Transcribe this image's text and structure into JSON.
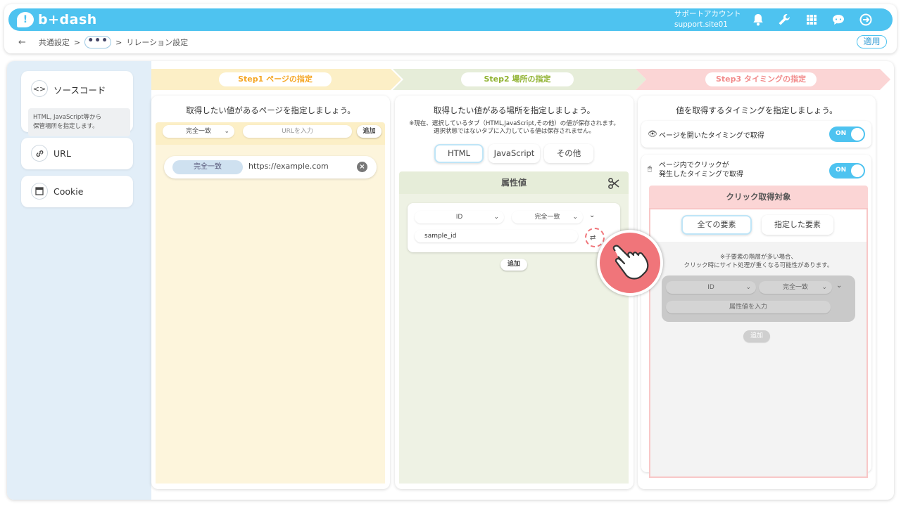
{
  "header": {
    "logo_text": "b+dash",
    "account_name": "サポートアカウント",
    "account_id": "support.site01",
    "icons": [
      "bell-icon",
      "wrench-icon",
      "grid-icon",
      "support-bubble-icon",
      "logout-icon"
    ]
  },
  "breadcrumb": {
    "back": "←",
    "item1": "共通設定",
    "sep": ">",
    "more": "•••",
    "current": "リレーション設定"
  },
  "apply_label": "適用",
  "sidebar": {
    "source": {
      "icon": "code-icon",
      "label": "ソースコード",
      "desc_line1": "HTML, JavaScript等から",
      "desc_line2": "保管場所を指定します。"
    },
    "url": {
      "icon": "link-icon",
      "label": "URL"
    },
    "cookie": {
      "icon": "cookie-window-icon",
      "label": "Cookie"
    }
  },
  "steps": [
    {
      "label": "Step1 ページの指定",
      "color": "#f5a623",
      "bg": "#fcefc6"
    },
    {
      "label": "Step2 場所の指定",
      "color": "#8fb22f",
      "bg": "#e6edd9"
    },
    {
      "label": "Step3 タイミングの指定",
      "color": "#f28b8b",
      "bg": "#fbd5d5"
    }
  ],
  "step1": {
    "title": "取得したい値があるページを指定しましょう。",
    "match_select": "完全一致",
    "url_placeholder": "URLを入力",
    "add_label": "追加",
    "rows": [
      {
        "match": "完全一致",
        "url": "https://example.com"
      }
    ]
  },
  "step2": {
    "title": "取得したい値がある場所を指定しましょう。",
    "note_line1": "※現在、選択しているタブ（HTML,JavaScript,その他）の値が保存されます。",
    "note_line2": "選択状態ではないタブに入力している値は保存されません。",
    "tabs": [
      {
        "label": "HTML",
        "active": true
      },
      {
        "label": "JavaScript",
        "active": false
      },
      {
        "label": "その他",
        "active": false
      }
    ],
    "attr_header": "属性値",
    "attr_type": "ID",
    "attr_match": "完全一致",
    "attr_value": "sample_id",
    "add_label": "追加"
  },
  "step3": {
    "title": "値を取得するタイミングを指定しましょう。",
    "option1": "ページを開いたタイミングで取得",
    "option2_line1": "ページ内でクリックが",
    "option2_line2": "発生したタイミングで取得",
    "toggle_on": "ON",
    "click_header": "クリック取得対象",
    "target_all": "全ての要素",
    "target_specified": "指定した要素",
    "warning_line1": "※子要素の階層が多い場合、",
    "warning_line2": "クリック時にサイト処理が重くなる可能性があります。",
    "attr_type": "ID",
    "attr_match": "完全一致",
    "attr_placeholder": "属性値を入力",
    "add_label": "追加"
  }
}
